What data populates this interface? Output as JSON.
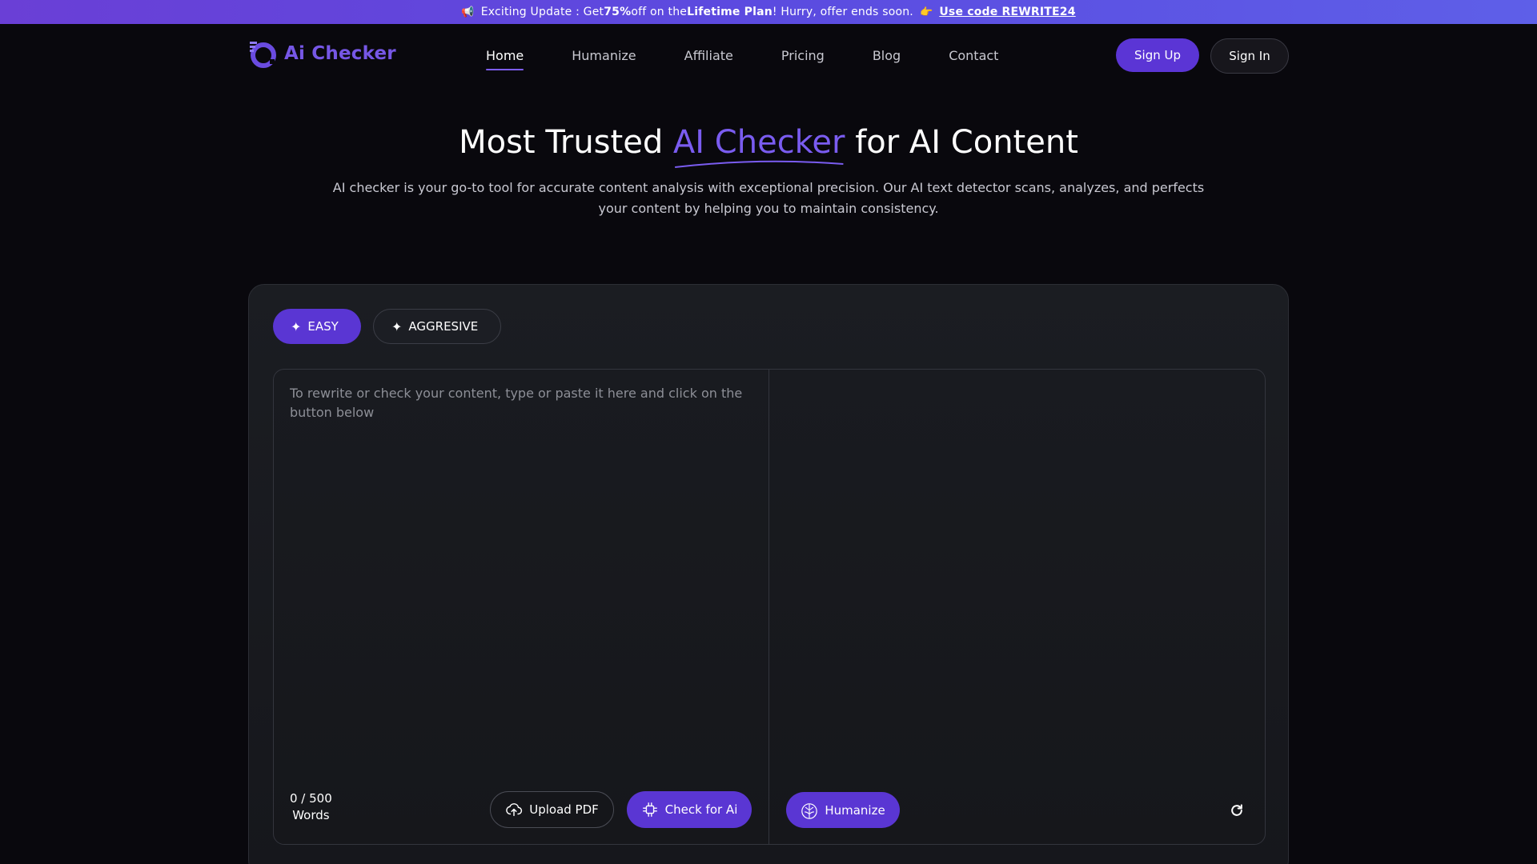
{
  "announcement": {
    "megaphone_icon": "megaphone-icon",
    "text_1": "Exciting Update : Get ",
    "text_bold_1": "75%",
    "text_2": " off on the ",
    "text_bold_2": "Lifetime Plan",
    "text_3": " ! Hurry, offer ends soon.",
    "pointer_icon": "pointing-hand-icon",
    "code_link": "Use code REWRITE24"
  },
  "header": {
    "logo_text": "Ai Checker",
    "nav": [
      {
        "label": "Home",
        "active": true
      },
      {
        "label": "Humanize",
        "active": false
      },
      {
        "label": "Affiliate",
        "active": false
      },
      {
        "label": "Pricing",
        "active": false
      },
      {
        "label": "Blog",
        "active": false
      },
      {
        "label": "Contact",
        "active": false
      }
    ],
    "signup_label": "Sign Up",
    "signin_label": "Sign In"
  },
  "hero": {
    "title_before": "Most Trusted ",
    "title_accent": "AI Checker",
    "title_after": " for AI Content",
    "subtitle": "AI checker is your go-to tool for accurate content analysis with exceptional precision. Our AI text detector scans, analyzes, and perfects your content by helping you to maintain consistency."
  },
  "tool": {
    "modes": [
      {
        "label": "EASY",
        "selected": true
      },
      {
        "label": "AGGRESIVE",
        "selected": false
      }
    ],
    "input": {
      "value": "",
      "placeholder": "To rewrite or check your content, type or paste it here and click on the button below"
    },
    "word_count": "0 / 500",
    "word_unit": "Words",
    "upload_label": "Upload PDF",
    "check_label": "Check for Ai",
    "humanize_label": "Humanize"
  },
  "colors": {
    "accent": "#5a36d3",
    "accent_text": "#7a5cf0",
    "background": "#09080d",
    "announcement_bar": "#6a3fd6"
  }
}
